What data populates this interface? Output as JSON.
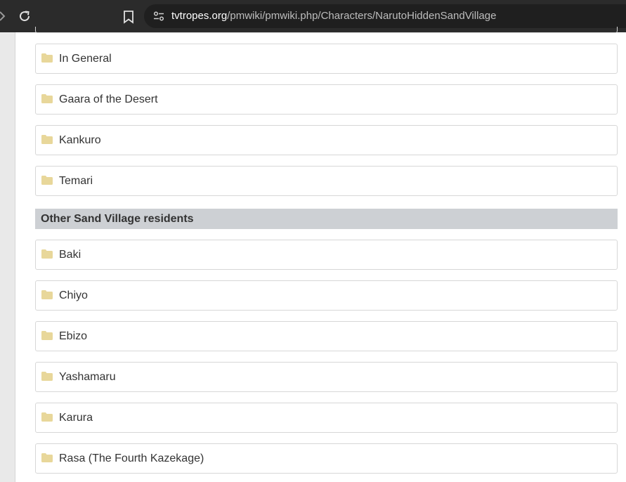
{
  "browser": {
    "url_host": "tvtropes.org",
    "url_path": "/pmwiki/pmwiki.php/Characters/NarutoHiddenSandVillage",
    "icons": [
      "forward-icon",
      "reload-icon",
      "bookmark-icon",
      "site-info-icon"
    ]
  },
  "folders_group_1": [
    {
      "label": "In General"
    },
    {
      "label": "Gaara of the Desert"
    },
    {
      "label": "Kankuro"
    },
    {
      "label": "Temari"
    }
  ],
  "section": {
    "title": "Other Sand Village residents"
  },
  "folders_group_2": [
    {
      "label": "Baki"
    },
    {
      "label": "Chiyo"
    },
    {
      "label": "Ebizo"
    },
    {
      "label": "Yashamaru"
    },
    {
      "label": "Karura"
    },
    {
      "label": "Rasa (The Fourth Kazekage)"
    }
  ],
  "colors": {
    "folder_icon": "#e8d79a",
    "section_bg": "#cdd0d4",
    "browser_bg": "#2b2b2b"
  }
}
